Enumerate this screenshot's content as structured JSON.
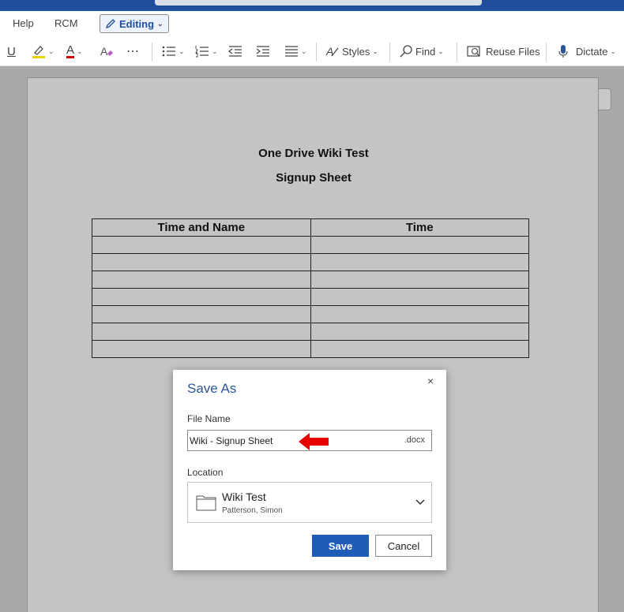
{
  "menu": {
    "help": "Help",
    "rcm": "RCM",
    "editing": "Editing"
  },
  "toolbar": {
    "font_color_glyph": "A",
    "styles": "Styles",
    "find": "Find",
    "reuse_files": "Reuse Files",
    "dictate": "Dictate"
  },
  "document": {
    "title": "One Drive Wiki Test",
    "subtitle": "Signup Sheet",
    "table": {
      "headers": [
        "Time and Name",
        "Time"
      ],
      "empty_rows": 7
    }
  },
  "dialog": {
    "title": "Save As",
    "close_glyph": "×",
    "file_name_label": "File Name",
    "file_name_value": "Wiki - Signup Sheet",
    "extension": ".docx",
    "location_label": "Location",
    "location_name": "Wiki Test",
    "location_owner": "Patterson, Simon",
    "save_label": "Save",
    "cancel_label": "Cancel"
  },
  "colors": {
    "accent": "#2b579a",
    "save_button": "#1f5cb8",
    "annotation_arrow": "#e60000",
    "highlight": "#e8d400",
    "font_color": "#d00000"
  }
}
